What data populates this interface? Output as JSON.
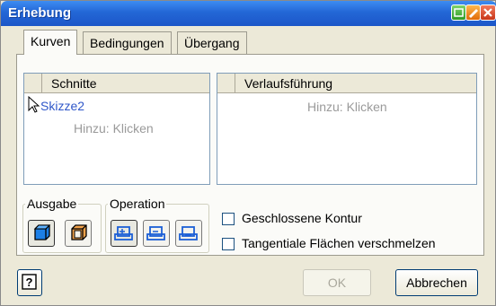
{
  "window": {
    "title": "Erhebung"
  },
  "tabs": [
    {
      "label": "Kurven",
      "active": true
    },
    {
      "label": "Bedingungen",
      "active": false
    },
    {
      "label": "Übergang",
      "active": false
    }
  ],
  "sections": {
    "schnitte": {
      "header": "Schnitte",
      "items": [
        "Skizze2"
      ],
      "add_hint": "Hinzu: Klicken"
    },
    "verlauf": {
      "header": "Verlaufsführung",
      "add_hint": "Hinzu: Klicken"
    }
  },
  "output_group": {
    "label": "Ausgabe",
    "icons": [
      "solid-output-icon",
      "surface-output-icon"
    ]
  },
  "operation_group": {
    "label": "Operation",
    "icons": [
      "join-icon",
      "cut-icon",
      "intersect-icon"
    ]
  },
  "options": {
    "closed_contour": {
      "label": "Geschlossene Kontur",
      "checked": false
    },
    "merge_tangent": {
      "label": "Tangentiale Flächen verschmelzen",
      "checked": false
    }
  },
  "buttons": {
    "help": "?",
    "ok": "OK",
    "cancel": "Abbrechen"
  },
  "colors": {
    "accent_blue": "#2f57c9",
    "output_orange": "#d9781f",
    "titlebar": "#2367d6"
  }
}
